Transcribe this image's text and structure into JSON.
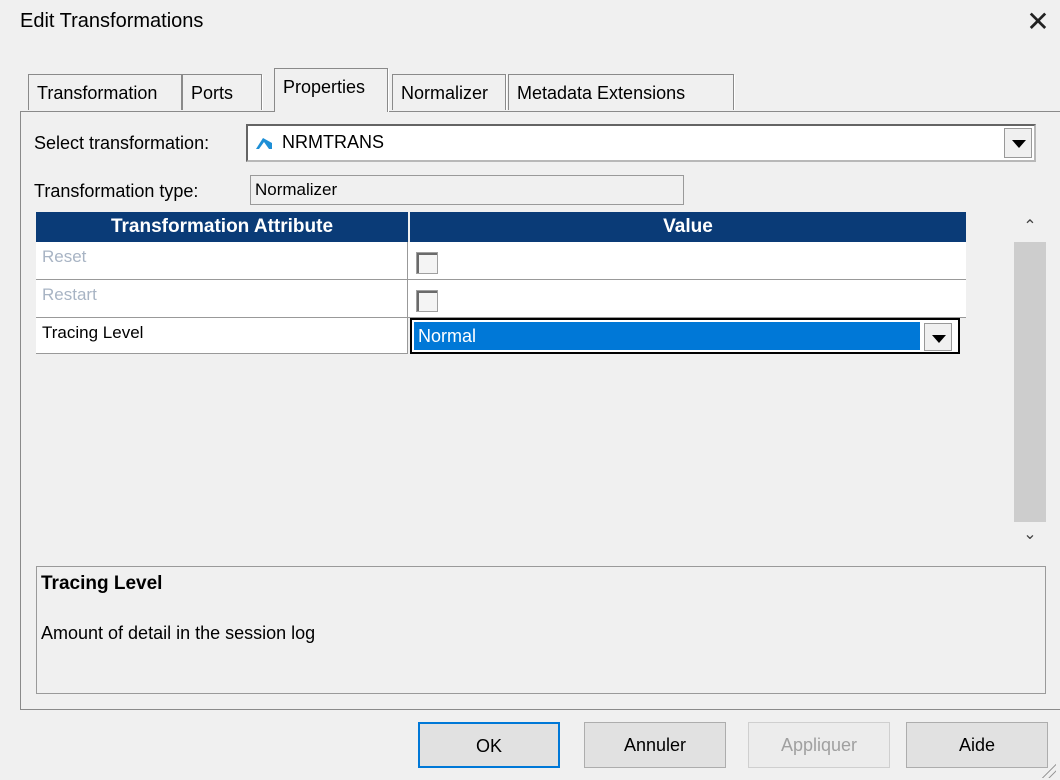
{
  "window": {
    "title": "Edit Transformations"
  },
  "tabs": [
    {
      "label": "Transformation"
    },
    {
      "label": "Ports"
    },
    {
      "label": "Properties"
    },
    {
      "label": "Normalizer"
    },
    {
      "label": "Metadata Extensions"
    }
  ],
  "form": {
    "select_label": "Select transformation:",
    "select_value": "NRMTRANS",
    "type_label": "Transformation type:",
    "type_value": "Normalizer"
  },
  "table": {
    "headers": [
      "Transformation Attribute",
      "Value"
    ],
    "rows": [
      {
        "attribute": "Reset",
        "enabled": false,
        "checked": false
      },
      {
        "attribute": "Restart",
        "enabled": false,
        "checked": false
      },
      {
        "attribute": "Tracing Level",
        "value": "Normal"
      }
    ]
  },
  "description": {
    "title": "Tracing Level",
    "text": "Amount of detail in the session log"
  },
  "buttons": {
    "ok": "OK",
    "cancel": "Annuler",
    "apply": "Appliquer",
    "help": "Aide"
  },
  "colors": {
    "header_bg": "#0a3b77",
    "selection": "#0078d7"
  },
  "icons": {
    "transformation": "normalizer-icon",
    "close": "close-icon"
  }
}
